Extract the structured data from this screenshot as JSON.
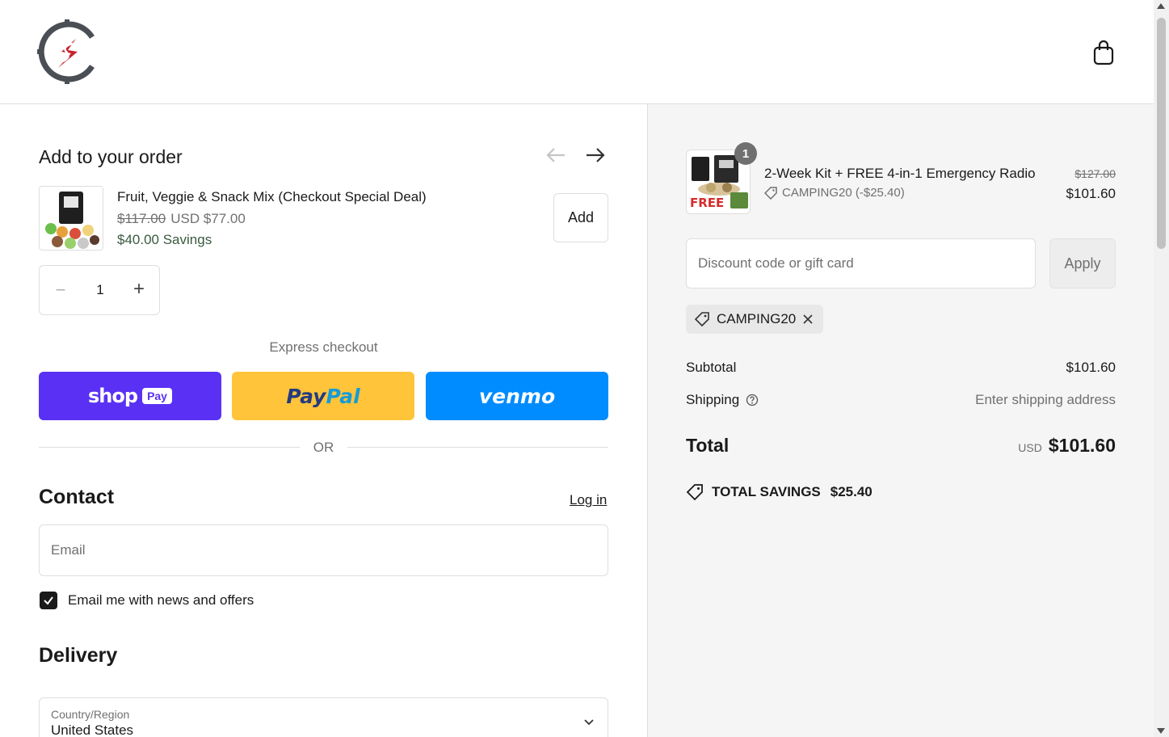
{
  "header": {
    "logo_icon": "compass-s-logo",
    "cart_icon": "shopping-bag-icon"
  },
  "upsell": {
    "title": "Add to your order",
    "product_name": "Fruit, Veggie & Snack Mix (Checkout Special Deal)",
    "old_price": "$117.00",
    "new_price": "USD $77.00",
    "savings": "$40.00 Savings",
    "add_label": "Add",
    "quantity": "1"
  },
  "express": {
    "label": "Express checkout",
    "shop_word": "shop",
    "shop_badge": "Pay",
    "paypal_a": "Pay",
    "paypal_b": "Pal",
    "venmo_word": "venmo",
    "or": "OR"
  },
  "contact": {
    "title": "Contact",
    "login": "Log in",
    "email_placeholder": "Email",
    "newsletter_label": "Email me with news and offers",
    "newsletter_checked": true
  },
  "delivery": {
    "title": "Delivery",
    "country_label": "Country/Region",
    "country_value": "United States"
  },
  "summary": {
    "item": {
      "quantity_badge": "1",
      "name": "2-Week Kit + FREE 4-in-1 Emergency Radio",
      "discount_code": "CAMPING20 (-$25.40)",
      "old_price": "$127.00",
      "price": "$101.60"
    },
    "discount_placeholder": "Discount code or gift card",
    "apply_label": "Apply",
    "applied_code": "CAMPING20",
    "subtotal_label": "Subtotal",
    "subtotal_value": "$101.60",
    "shipping_label": "Shipping",
    "shipping_value": "Enter shipping address",
    "total_label": "Total",
    "total_currency": "USD",
    "total_value": "$101.60",
    "savings_label": "TOTAL SAVINGS",
    "savings_value": "$25.40"
  },
  "colors": {
    "shop": "#5a31f4",
    "paypal": "#ffc439",
    "venmo": "#008cff"
  }
}
